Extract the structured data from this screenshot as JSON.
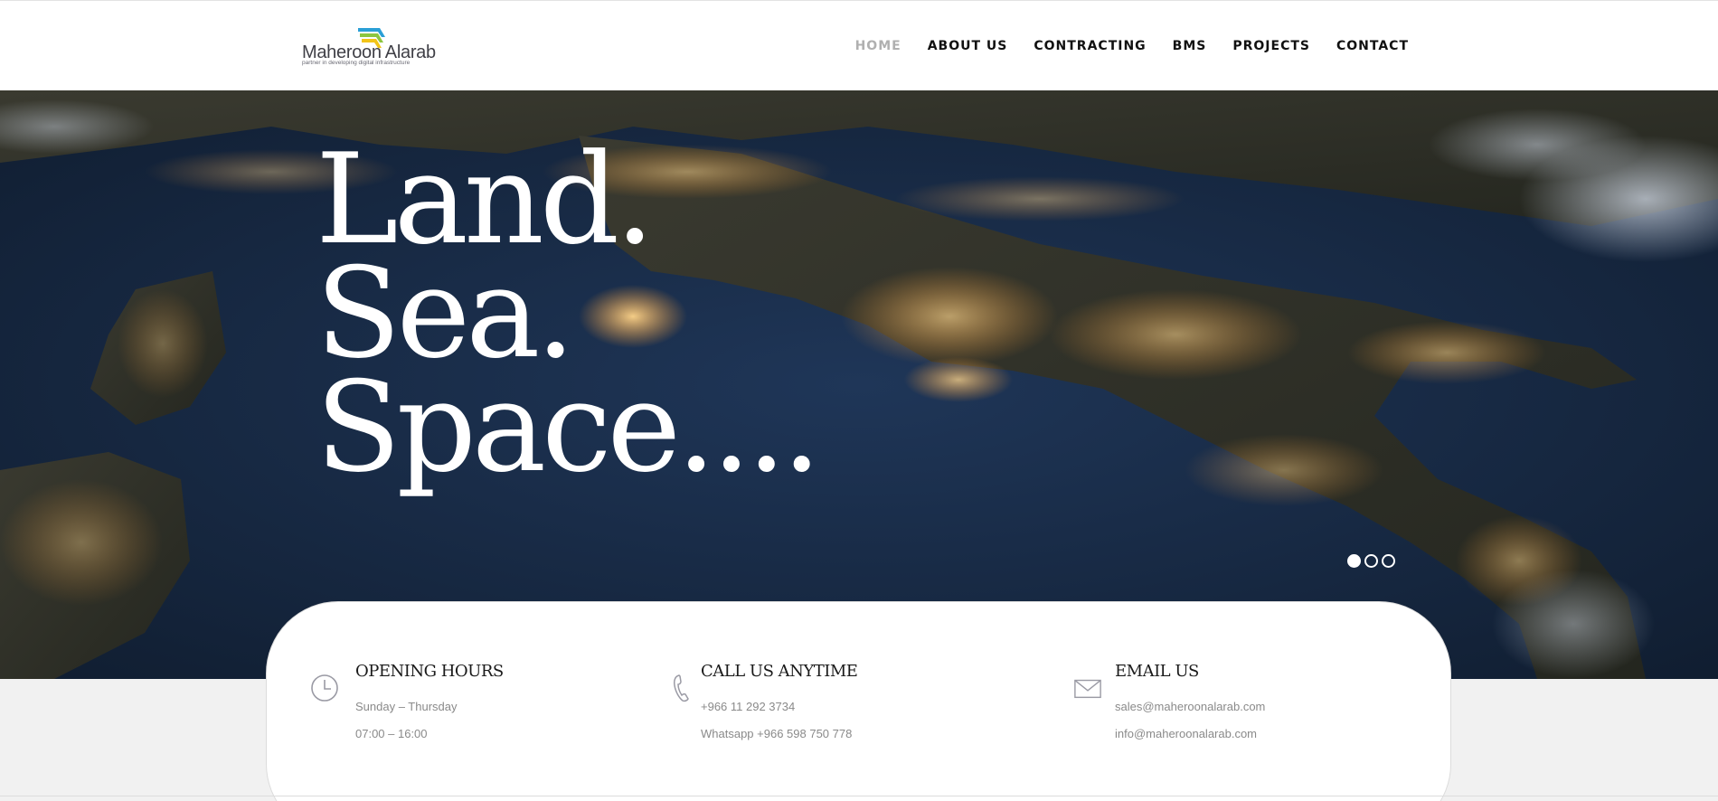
{
  "brand": {
    "name": "Maheroon Alarab",
    "tagline": "partner in developing digital infrastructure",
    "colors": [
      "#2a9fd6",
      "#8cc63f",
      "#f2c418",
      "#3f3f46"
    ]
  },
  "nav": {
    "items": [
      {
        "label": "HOME",
        "active": true
      },
      {
        "label": "ABOUT US"
      },
      {
        "label": "CONTRACTING"
      },
      {
        "label": "BMS"
      },
      {
        "label": "PROJECTS"
      },
      {
        "label": "CONTACT"
      }
    ]
  },
  "hero": {
    "lines": [
      "Land.",
      "Sea.",
      "Space...."
    ],
    "background": "satellite night view of lit coastline",
    "slides": {
      "count": 3,
      "active": 1
    }
  },
  "info": {
    "hours": {
      "icon": "clock-icon",
      "title": "OPENING HOURS",
      "lines": [
        "Sunday – Thursday",
        "07:00 – 16:00"
      ]
    },
    "call": {
      "icon": "phone-icon",
      "title": "CALL US ANYTIME",
      "lines": [
        "+966 11 292 3734",
        "Whatsapp +966 598 750 778"
      ]
    },
    "email": {
      "icon": "envelope-icon",
      "title": "EMAIL US",
      "lines": [
        "sales@maheroonalarab.com",
        "info@maheroonalarab.com"
      ]
    }
  },
  "colors": {
    "accent_text": "#111111",
    "muted": "#8a8a8a",
    "nav_active": "#b0b0b0"
  }
}
